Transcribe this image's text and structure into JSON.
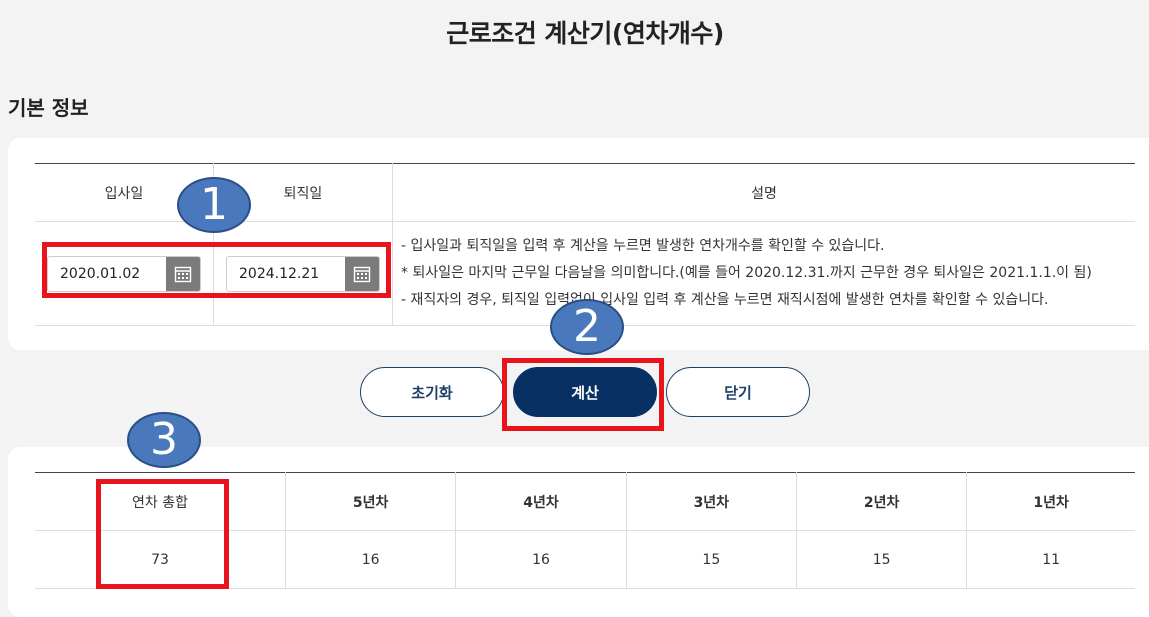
{
  "page": {
    "title": "근로조건 계산기(연차개수)"
  },
  "basic_info": {
    "section_title": "기본 정보",
    "headers": {
      "hire_date": "입사일",
      "retire_date": "퇴직일",
      "description": "설명"
    },
    "hire_date_value": "2020.01.02",
    "retire_date_value": "2024.12.21",
    "description_lines": [
      "- 입사일과 퇴직일을 입력 후 계산을 누르면 발생한 연차개수를 확인할 수 있습니다.",
      "* 퇴사일은 마지막 근무일 다음날을 의미합니다.(예를 들어 2020.12.31.까지 근무한 경우 퇴사일은 2021.1.1.이 됨)",
      "- 재직자의 경우, 퇴직일 입력없이 입사일 입력 후 계산을 누르면 재직시점에 발생한 연차를 확인할 수 있습니다."
    ]
  },
  "buttons": {
    "reset": "초기화",
    "calculate": "계산",
    "close": "닫기"
  },
  "result": {
    "headers": [
      "연차 총합",
      "5년차",
      "4년차",
      "3년차",
      "2년차",
      "1년차"
    ],
    "values": [
      "73",
      "16",
      "16",
      "15",
      "15",
      "11"
    ]
  },
  "annotations": {
    "marker1": "1",
    "marker2": "2",
    "marker3": "3"
  },
  "colors": {
    "primary": "#073063",
    "highlight": "#e8141c",
    "marker": "#4a78bd"
  }
}
